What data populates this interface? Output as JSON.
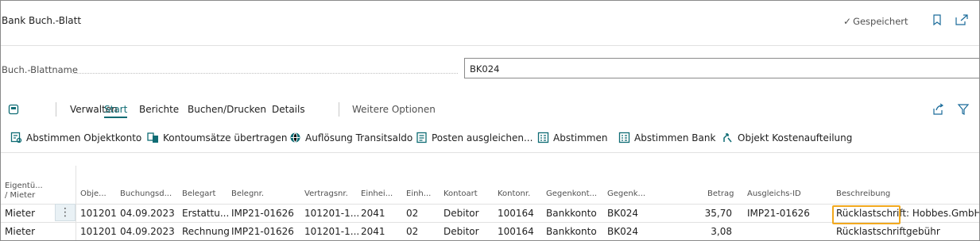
{
  "header": {
    "title": "Bank Buch.-Blatt",
    "saved_label": "Gespeichert",
    "bookmark_icon": "bookmark-icon",
    "open_new_icon": "open-new-window-icon"
  },
  "field": {
    "label": "Buch.-Blattname",
    "value": "BK024"
  },
  "actionbar": {
    "items": [
      "Verwalten",
      "Start",
      "Berichte",
      "Buchen/Drucken",
      "Details",
      "Weitere Optionen"
    ],
    "active": "Start"
  },
  "promoted_actions": [
    {
      "label": "Abstimmen Objektkonto",
      "icon": "reconcile-icon"
    },
    {
      "label": "Kontoumsätze übertragen",
      "icon": "transfer-icon"
    },
    {
      "label": "Auflösung Transitsaldo",
      "icon": "globe-icon"
    },
    {
      "label": "Posten ausgleichen...",
      "icon": "apply-entries-icon"
    },
    {
      "label": "Abstimmen",
      "icon": "list-icon"
    },
    {
      "label": "Abstimmen Bank",
      "icon": "list-icon"
    },
    {
      "label": "Objekt Kostenaufteilung",
      "icon": "split-icon"
    }
  ],
  "table": {
    "columns": [
      "Eigentü... / Mieter",
      "Obje...",
      "Buchungsd...",
      "Belegart",
      "Belegnr.",
      "Vertragsnr.",
      "Einhei...",
      "Einh...",
      "Kontoart",
      "Kontonr.",
      "Gegenkont...",
      "Gegenk...",
      "Betrag",
      "Ausgleichs-ID",
      "Beschreibung"
    ],
    "col_first_line": "Eigentü...",
    "col_second_line": "/ Mieter",
    "rows": [
      [
        "Mieter",
        "101201",
        "04.09.2023",
        "Erstattu...",
        "IMP21-01626",
        "101201-1...",
        "2041",
        "02",
        "Debitor",
        "100164",
        "Bankkonto",
        "BK024",
        "35,70",
        "IMP21-01626",
        "Rücklastschrift: Hobbes.GmbH"
      ],
      [
        "Mieter",
        "101201",
        "04.09.2023",
        "Rechnung",
        "IMP21-01626",
        "101201-1...",
        "2041",
        "02",
        "Debitor",
        "100164",
        "Bankkonto",
        "BK024",
        "3,08",
        "",
        "Rücklastschriftgebühr"
      ]
    ]
  },
  "colors": {
    "accent": "#0f6c74",
    "highlight": "#f2a91e"
  }
}
